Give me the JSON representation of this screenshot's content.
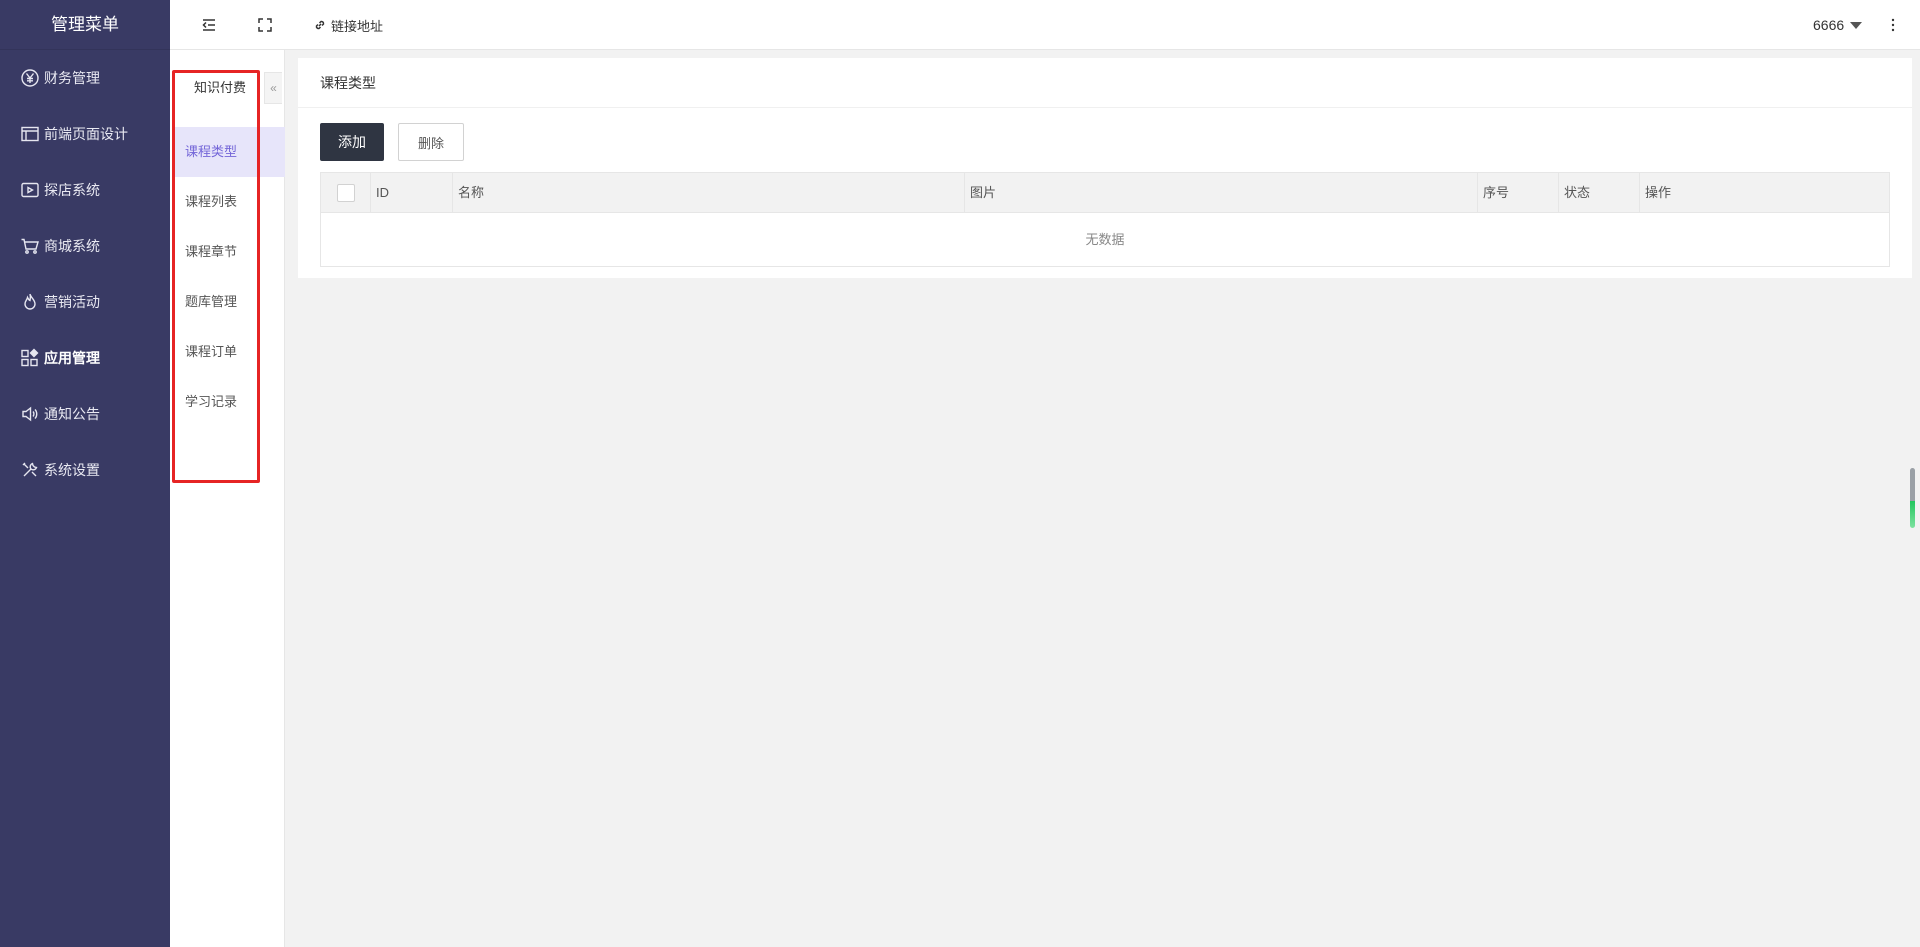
{
  "sidebar": {
    "title": "管理菜单",
    "items": [
      {
        "label": "财务管理",
        "icon": "yen-icon"
      },
      {
        "label": "前端页面设计",
        "icon": "layout-icon"
      },
      {
        "label": "探店系统",
        "icon": "video-icon"
      },
      {
        "label": "商城系统",
        "icon": "cart-icon"
      },
      {
        "label": "营销活动",
        "icon": "fire-icon"
      },
      {
        "label": "应用管理",
        "icon": "apps-icon",
        "active": true
      },
      {
        "label": "通知公告",
        "icon": "speaker-icon"
      },
      {
        "label": "系统设置",
        "icon": "tools-icon"
      }
    ]
  },
  "topbar": {
    "link_label": "链接地址",
    "user_name": "6666"
  },
  "subpanel": {
    "tab_label": "知识付费",
    "collapse_glyph": "«",
    "items": [
      {
        "label": "课程类型",
        "active": true
      },
      {
        "label": "课程列表"
      },
      {
        "label": "课程章节"
      },
      {
        "label": "题库管理"
      },
      {
        "label": "课程订单"
      },
      {
        "label": "学习记录"
      }
    ]
  },
  "main": {
    "title": "课程类型",
    "add_label": "添加",
    "delete_label": "删除",
    "table": {
      "columns": [
        "ID",
        "名称",
        "图片",
        "序号",
        "状态",
        "操作"
      ],
      "empty_text": "无数据"
    }
  },
  "colors": {
    "sidebar_bg": "#393a64",
    "accent": "#7466d8",
    "primary_button": "#2f3542",
    "highlight_frame": "#e62424"
  }
}
